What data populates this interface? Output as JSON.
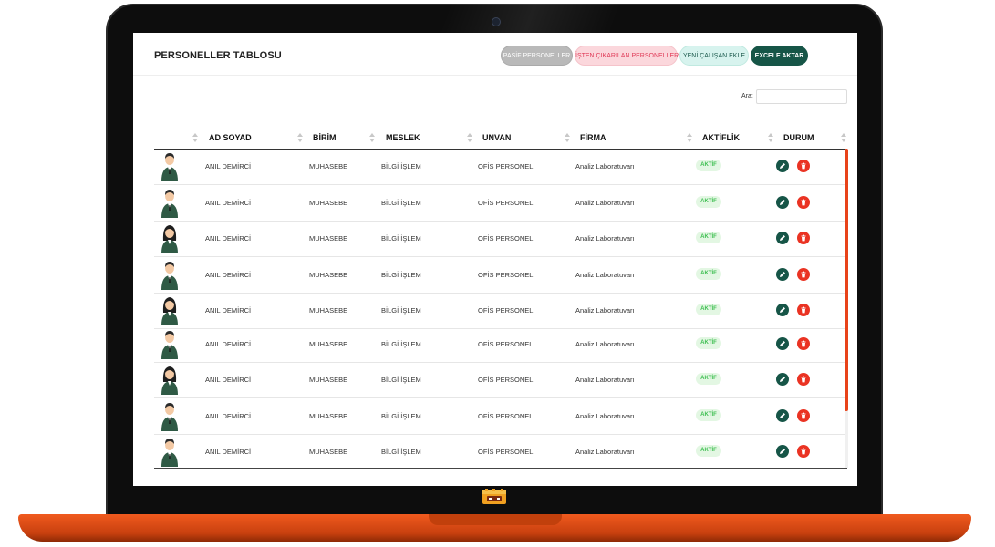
{
  "header": {
    "title": "PERSONELLER TABLOSU",
    "buttons": {
      "passive": "PASİF PERSONELLER",
      "fired": "İŞTEN ÇIKARILAN PERSONELLER",
      "new": "YENİ ÇALIŞAN EKLE",
      "excel": "EXCELE AKTAR"
    }
  },
  "search": {
    "label": "Ara:",
    "value": ""
  },
  "table": {
    "columns": [
      "AD SOYAD",
      "BİRİM",
      "MESLEK",
      "UNVAN",
      "FİRMA",
      "AKTİFLİK",
      "DURUM"
    ],
    "rows": [
      {
        "avatar": "male",
        "name": "ANIL DEMİRCİ",
        "unit": "MUHASEBE",
        "job": "BİLGİ İŞLEM",
        "title": "OFİS PERSONELİ",
        "company": "Analiz Laboratuvarı",
        "status": "AKTİF"
      },
      {
        "avatar": "male",
        "name": "ANIL DEMİRCİ",
        "unit": "MUHASEBE",
        "job": "BİLGİ İŞLEM",
        "title": "OFİS PERSONELİ",
        "company": "Analiz Laboratuvarı",
        "status": "AKTİF"
      },
      {
        "avatar": "female",
        "name": "ANIL DEMİRCİ",
        "unit": "MUHASEBE",
        "job": "BİLGİ İŞLEM",
        "title": "OFİS PERSONELİ",
        "company": "Analiz Laboratuvarı",
        "status": "AKTİF"
      },
      {
        "avatar": "male",
        "name": "ANIL DEMİRCİ",
        "unit": "MUHASEBE",
        "job": "BİLGİ İŞLEM",
        "title": "OFİS PERSONELİ",
        "company": "Analiz Laboratuvarı",
        "status": "AKTİF"
      },
      {
        "avatar": "female",
        "name": "ANIL DEMİRCİ",
        "unit": "MUHASEBE",
        "job": "BİLGİ İŞLEM",
        "title": "OFİS PERSONELİ",
        "company": "Analiz Laboratuvarı",
        "status": "AKTİF"
      },
      {
        "avatar": "male",
        "name": "ANIL DEMİRCİ",
        "unit": "MUHASEBE",
        "job": "BİLGİ İŞLEM",
        "title": "OFİS PERSONELİ",
        "company": "Analiz Laboratuvarı",
        "status": "AKTİF"
      },
      {
        "avatar": "female",
        "name": "ANIL DEMİRCİ",
        "unit": "MUHASEBE",
        "job": "BİLGİ İŞLEM",
        "title": "OFİS PERSONELİ",
        "company": "Analiz Laboratuvarı",
        "status": "AKTİF"
      },
      {
        "avatar": "male",
        "name": "ANIL DEMİRCİ",
        "unit": "MUHASEBE",
        "job": "BİLGİ İŞLEM",
        "title": "OFİS PERSONELİ",
        "company": "Analiz Laboratuvarı",
        "status": "AKTİF"
      },
      {
        "avatar": "male",
        "name": "ANIL DEMİRCİ",
        "unit": "MUHASEBE",
        "job": "BİLGİ İŞLEM",
        "title": "OFİS PERSONELİ",
        "company": "Analiz Laboratuvarı",
        "status": "AKTİF"
      }
    ]
  },
  "icons": {
    "sort": "sort-icon",
    "edit": "pencil-icon",
    "delete": "trash-icon",
    "avatar": "person-avatar-icon"
  },
  "colors": {
    "primary": "#165547",
    "danger": "#ea3323",
    "accent": "#e8431a",
    "active_badge_bg": "#e3f7e3",
    "active_badge_text": "#3fbf52"
  }
}
